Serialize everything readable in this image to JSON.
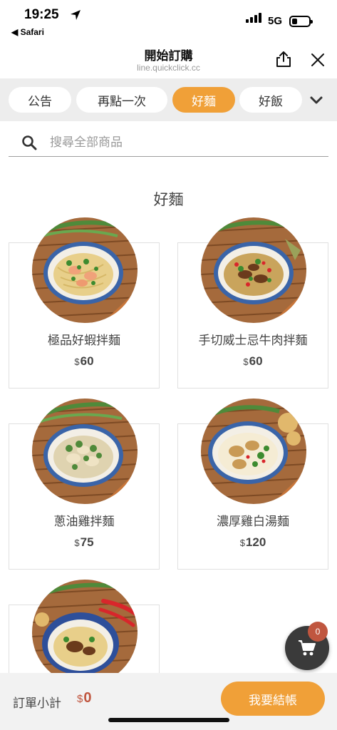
{
  "status_bar": {
    "time": "19:25",
    "back_app": "◀ Safari",
    "network": "5G"
  },
  "header": {
    "title": "開始訂購",
    "url": "line.quickclick.cc"
  },
  "tabs": [
    {
      "label": "公告"
    },
    {
      "label": "再點一次"
    },
    {
      "label": "好麵",
      "active": true
    },
    {
      "label": "好飯"
    }
  ],
  "search": {
    "placeholder": "搜尋全部商品"
  },
  "section": {
    "title": "好麵"
  },
  "products": [
    {
      "name": "極品好蝦拌麵",
      "currency": "$",
      "price": "60"
    },
    {
      "name": "手切威士忌牛肉拌麵",
      "currency": "$",
      "price": "60"
    },
    {
      "name": "蔥油雞拌麵",
      "currency": "$",
      "price": "75"
    },
    {
      "name": "濃厚雞白湯麵",
      "currency": "$",
      "price": "120"
    },
    {
      "name": "",
      "currency": "",
      "price": ""
    }
  ],
  "cart": {
    "count": "0"
  },
  "footer": {
    "subtotal_label": "訂單小計",
    "subtotal_currency": "$",
    "subtotal_value": "0",
    "checkout_label": "我要結帳"
  },
  "colors": {
    "accent": "#f0a038",
    "price_red": "#c0563f",
    "tab_bar_bg": "#ededed"
  }
}
